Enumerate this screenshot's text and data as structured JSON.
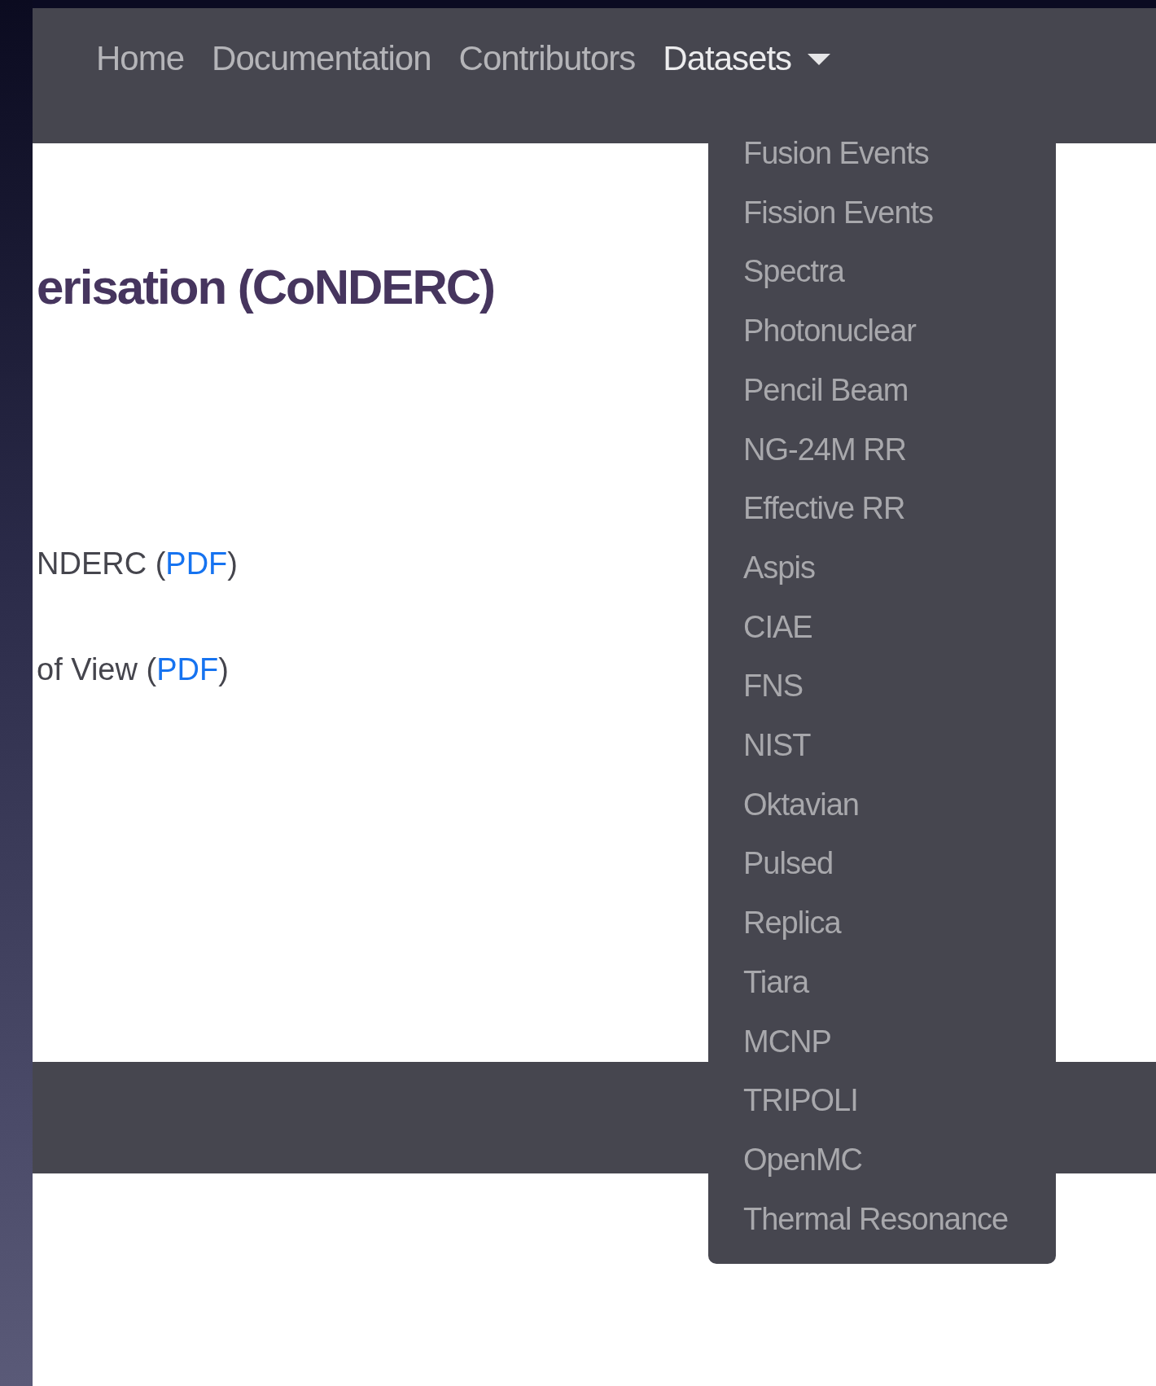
{
  "navbar": {
    "items": [
      {
        "label": "Home",
        "selected": false
      },
      {
        "label": "Documentation",
        "selected": false
      },
      {
        "label": "Contributors",
        "selected": false
      },
      {
        "label": "Datasets",
        "selected": true,
        "expanded": true
      }
    ]
  },
  "heading": "erisation (CoNDERC)",
  "links": [
    {
      "text": "NDERC (",
      "link": "PDF",
      "after": ")"
    },
    {
      "text": "of View (",
      "link": "PDF",
      "after": ")"
    }
  ],
  "dropdown": {
    "items": [
      "Fusion Events",
      "Fission Events",
      "Spectra",
      "Photonuclear",
      "Pencil Beam",
      "NG-24M RR",
      "Effective RR",
      "Aspis",
      "CIAE",
      "FNS",
      "NIST",
      "Oktavian",
      "Pulsed",
      "Replica",
      "Tiara",
      "MCNP",
      "TRIPOLI",
      "OpenMC",
      "Thermal Resonance"
    ]
  }
}
